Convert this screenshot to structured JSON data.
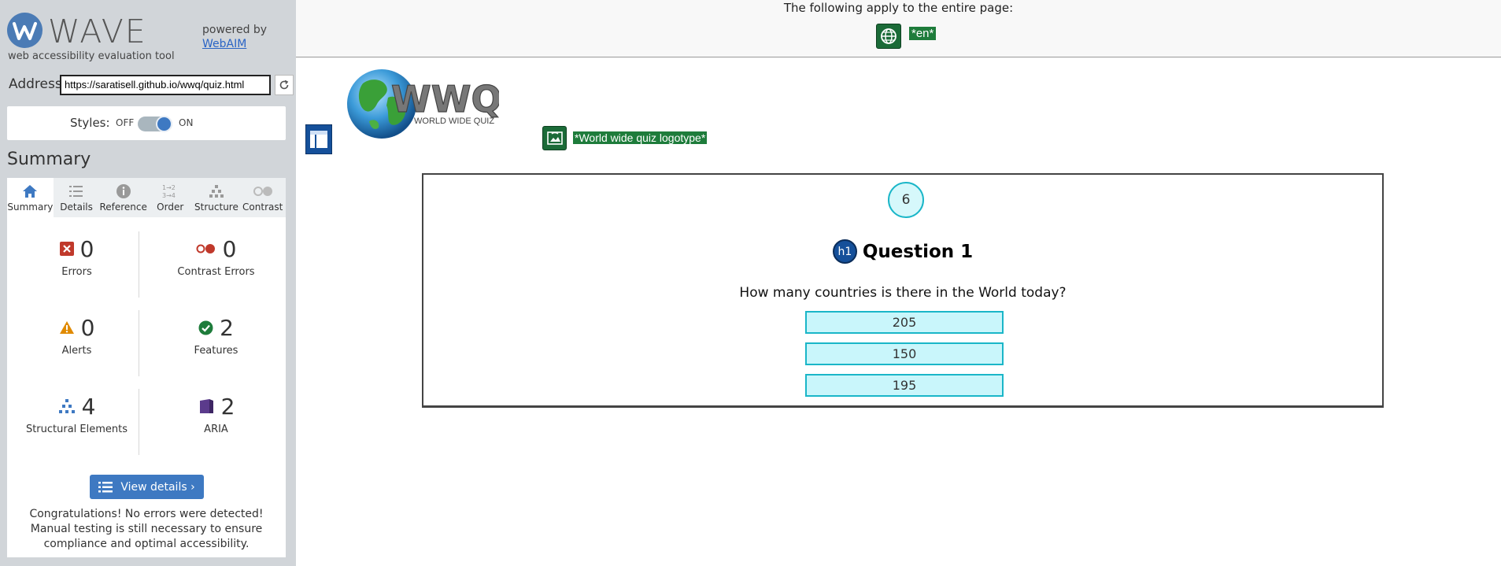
{
  "wave": {
    "logo_text": "WAVE",
    "tagline": "web accessibility evaluation tool",
    "powered_by": "powered by",
    "webaim_link": "WebAIM",
    "address_label": "Address:",
    "address_value": "https://saratisell.github.io/wwq/quiz.html",
    "styles_label": "Styles:",
    "styles_off": "OFF",
    "styles_on": "ON",
    "summary_title": "Summary",
    "tabs": [
      {
        "label": "Summary",
        "icon": "home-icon",
        "active": true
      },
      {
        "label": "Details",
        "icon": "list-icon",
        "active": false
      },
      {
        "label": "Reference",
        "icon": "info-icon",
        "active": false
      },
      {
        "label": "Order",
        "icon": "order-icon",
        "active": false
      },
      {
        "label": "Structure",
        "icon": "structure-icon",
        "active": false
      },
      {
        "label": "Contrast",
        "icon": "contrast-icon",
        "active": false
      }
    ],
    "stats": {
      "errors": {
        "count": "0",
        "label": "Errors"
      },
      "contrast_errors": {
        "count": "0",
        "label": "Contrast Errors"
      },
      "alerts": {
        "count": "0",
        "label": "Alerts"
      },
      "features": {
        "count": "2",
        "label": "Features"
      },
      "structural": {
        "count": "4",
        "label": "Structural Elements"
      },
      "aria": {
        "count": "2",
        "label": "ARIA"
      }
    },
    "view_details": "View details ›",
    "congrats": "Congratulations! No errors were detected! Manual testing is still necessary to ensure compliance and optimal accessibility."
  },
  "page": {
    "applies_text": "The following apply to the entire page:",
    "lang_tag": "*en*",
    "logo_text": "WWQ",
    "logo_subtext": "WORLD WIDE QUIZ",
    "alt_text": "*World wide quiz logotype*",
    "counter": "6",
    "h1_badge": "h1",
    "question_title": "Question 1",
    "question_text": "How many countries is there in the World today?",
    "answers": [
      "205",
      "150",
      "195"
    ]
  },
  "colors": {
    "sidebar_bg": "#d1d5d9",
    "wave_blue": "#3e79c2",
    "feature_green": "#1e7c3b",
    "quiz_cyan": "#1ab6c8",
    "error_red": "#c0392b",
    "alert_orange": "#e08a00",
    "aria_purple": "#5b3b8c"
  }
}
